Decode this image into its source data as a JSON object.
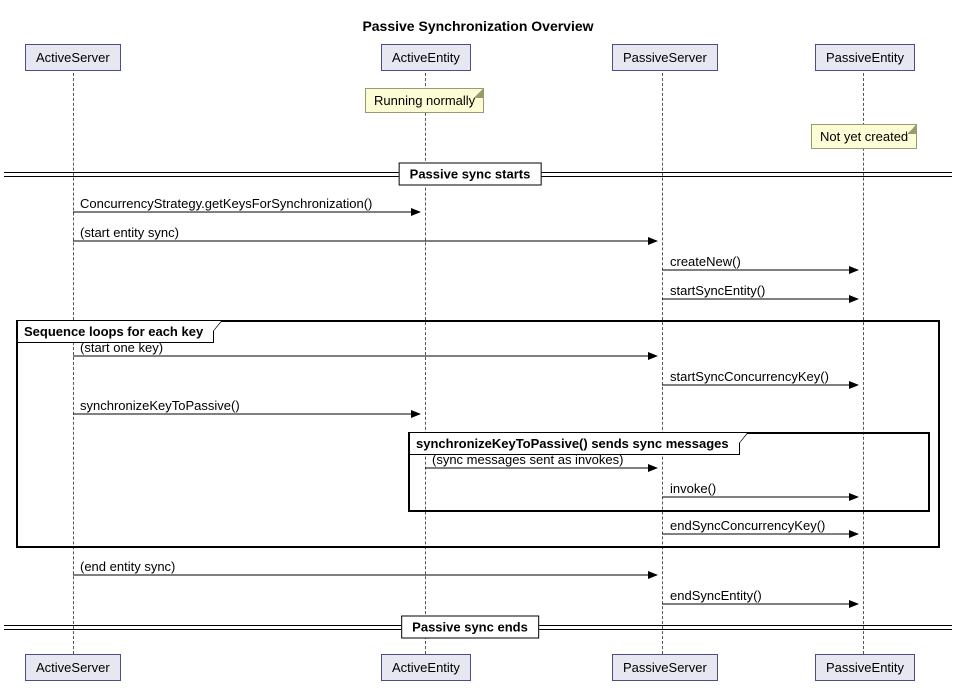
{
  "title": "Passive Synchronization Overview",
  "participants": {
    "activeServer": "ActiveServer",
    "activeEntity": "ActiveEntity",
    "passiveServer": "PassiveServer",
    "passiveEntity": "PassiveEntity"
  },
  "notes": {
    "runningNormally": "Running normally",
    "notYetCreated": "Not yet created"
  },
  "dividers": {
    "start": "Passive sync starts",
    "end": "Passive sync ends"
  },
  "groups": {
    "loopKeys": "Sequence loops for each key",
    "syncMessages": "synchronizeKeyToPassive() sends sync messages"
  },
  "messages": {
    "getKeys": "ConcurrencyStrategy.getKeysForSynchronization()",
    "startEntitySync": "(start entity sync)",
    "createNew": "createNew()",
    "startSyncEntity": "startSyncEntity()",
    "startOneKey": "(start one key)",
    "startSyncConcurrencyKey": "startSyncConcurrencyKey()",
    "synchronizeKeyToPassive": "synchronizeKeyToPassive()",
    "syncInvokes": "(sync messages sent as invokes)",
    "invoke": "invoke()",
    "endSyncConcurrencyKey": "endSyncConcurrencyKey()",
    "endEntitySync": "(end entity sync)",
    "endSyncEntity": "endSyncEntity()"
  },
  "chart_data": {
    "type": "sequence-diagram",
    "title": "Passive Synchronization Overview",
    "participants": [
      "ActiveServer",
      "ActiveEntity",
      "PassiveServer",
      "PassiveEntity"
    ],
    "notes": [
      {
        "over": "ActiveEntity",
        "text": "Running normally"
      },
      {
        "over": "PassiveEntity",
        "text": "Not yet created"
      }
    ],
    "steps": [
      {
        "divider": "Passive sync starts"
      },
      {
        "from": "ActiveServer",
        "to": "ActiveEntity",
        "label": "ConcurrencyStrategy.getKeysForSynchronization()"
      },
      {
        "from": "ActiveServer",
        "to": "PassiveServer",
        "label": "(start entity sync)"
      },
      {
        "from": "PassiveServer",
        "to": "PassiveEntity",
        "label": "createNew()"
      },
      {
        "from": "PassiveServer",
        "to": "PassiveEntity",
        "label": "startSyncEntity()"
      },
      {
        "group": "Sequence loops for each key",
        "steps": [
          {
            "from": "ActiveServer",
            "to": "PassiveServer",
            "label": "(start one key)"
          },
          {
            "from": "PassiveServer",
            "to": "PassiveEntity",
            "label": "startSyncConcurrencyKey()"
          },
          {
            "from": "ActiveServer",
            "to": "ActiveEntity",
            "label": "synchronizeKeyToPassive()"
          },
          {
            "group": "synchronizeKeyToPassive() sends sync messages",
            "steps": [
              {
                "from": "ActiveEntity",
                "to": "PassiveServer",
                "label": "(sync messages sent as invokes)"
              },
              {
                "from": "PassiveServer",
                "to": "PassiveEntity",
                "label": "invoke()"
              }
            ]
          },
          {
            "from": "PassiveServer",
            "to": "PassiveEntity",
            "label": "endSyncConcurrencyKey()"
          }
        ]
      },
      {
        "from": "ActiveServer",
        "to": "PassiveServer",
        "label": "(end entity sync)"
      },
      {
        "from": "PassiveServer",
        "to": "PassiveEntity",
        "label": "endSyncEntity()"
      },
      {
        "divider": "Passive sync ends"
      }
    ]
  }
}
